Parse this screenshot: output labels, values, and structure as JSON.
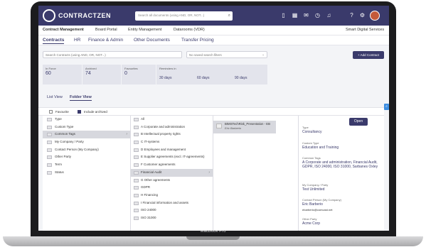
{
  "app": {
    "brand": "CONTRACTZEN",
    "search_placeholder": "Search all documents (using AND, OR, NOT...)"
  },
  "nav_primary": [
    "Contract Management",
    "Board Portal",
    "Entity Management",
    "Datarooms (VDR)"
  ],
  "company": "Smart Digital Services",
  "nav_secondary": [
    "Contracts",
    "HR",
    "Finance & Admin",
    "Other Documents",
    "Transfer Pricing"
  ],
  "filters": {
    "search_placeholder": "Search Contracts (using AND, OR, NOT...)",
    "saved_filters": "No saved search filters",
    "add_button": "+ Add Contract"
  },
  "stats": [
    {
      "label": "In Force",
      "value": "60"
    },
    {
      "label": "Archived",
      "value": "74"
    },
    {
      "label": "Favourites",
      "value": "0"
    }
  ],
  "reminders": {
    "label": "Reminders in",
    "values": [
      "30 days",
      "60 days",
      "90 days"
    ]
  },
  "views": {
    "list": "List View",
    "folder": "Folder View"
  },
  "options": {
    "favourite": "Favourite",
    "include_archived": "Include archived",
    "include_archived_checked": true
  },
  "column1": [
    "Type",
    "Custom Type",
    "Common Tags",
    "My Company / Party",
    "Contact Person (My Company)",
    "Other Party",
    "Term",
    "Status"
  ],
  "column2": [
    "All",
    "A Corporate and administration",
    "B Intellectual property rights",
    "C IT-systems",
    "D Employees and management",
    "E Supplier agreements (excl. IT-agreements)",
    "F Customer agreements",
    "Financial Audit",
    "G Other agreements",
    "GDPR",
    "H Financing",
    "I Financial information and assets",
    "ISO 24000",
    "ISO 31000"
  ],
  "document": {
    "title": "BIMSTechRisk_Presentation - EB",
    "author": "Eric Barberio"
  },
  "details": {
    "open_button": "Open",
    "fields": [
      {
        "label": "Type",
        "value": "Consultancy"
      },
      {
        "label": "Custom Type",
        "value": "Education and Training"
      },
      {
        "label": "Common Tags",
        "value": "A Corporate and administration, Financial Audit, GDPR, ISO 24000, ISO 31000, Sarbanes Oxley"
      },
      {
        "label": "My Company / Party",
        "value": "Test Unlimited"
      },
      {
        "label": "Contact Person (My Company)",
        "value": "Eric Barberio",
        "extra": "ebarberio@comcast.net"
      },
      {
        "label": "Other Party",
        "value": "Acme Corp"
      }
    ]
  },
  "device_label": "MacBook Pro"
}
